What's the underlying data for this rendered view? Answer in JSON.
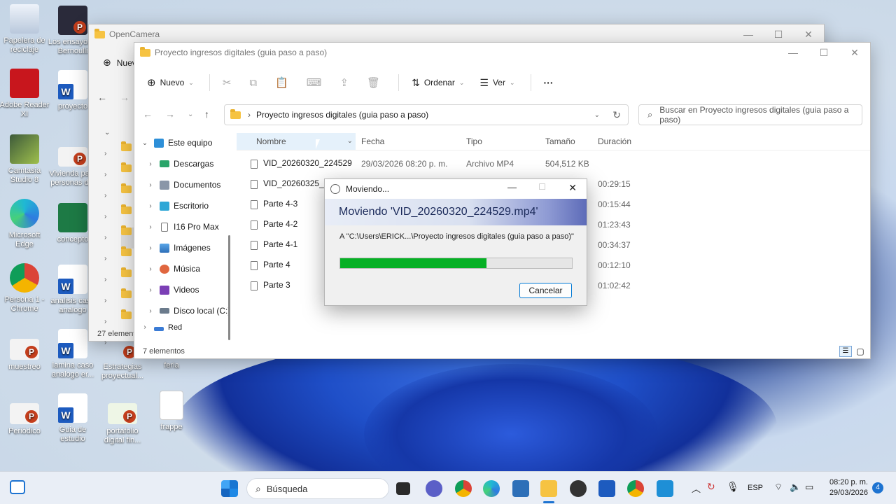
{
  "desktop": {
    "icons": [
      {
        "label": "Papelera de reciclaje"
      },
      {
        "label": "Adobe Reader XI"
      },
      {
        "label": "Camtasia Studio 8"
      },
      {
        "label": "Microsoft Edge"
      },
      {
        "label": "Persona 1 - Chrome"
      },
      {
        "label": "muestreo"
      },
      {
        "label": "Periódico"
      },
      {
        "label": "Los ensayos y Bernoulli"
      },
      {
        "label": "proyecto"
      },
      {
        "label": "Vivienda para personas d..."
      },
      {
        "label": "concepto"
      },
      {
        "label": "analisis caso analogo"
      },
      {
        "label": "lamina caso analogo er..."
      },
      {
        "label": "Guia de estudio"
      },
      {
        "label": "Estrategias proyectual..."
      },
      {
        "label": "portafolio digital fin..."
      },
      {
        "label": "feria"
      },
      {
        "label": "frappe"
      }
    ]
  },
  "back_window": {
    "title": "OpenCamera",
    "new_label": "Nuevo",
    "status": "27 elementos"
  },
  "explorer": {
    "title": "Proyecto ingresos digitales (guia paso a paso)",
    "toolbar": {
      "new_label": "Nuevo",
      "sort_label": "Ordenar",
      "view_label": "Ver",
      "more_label": "···"
    },
    "address": "Proyecto ingresos digitales (guia paso a paso)",
    "search_placeholder": "Buscar en Proyecto ingresos digitales (guia paso a paso)",
    "nav": [
      {
        "label": "Este equipo"
      },
      {
        "label": "Descargas"
      },
      {
        "label": "Documentos"
      },
      {
        "label": "Escritorio"
      },
      {
        "label": "I16 Pro Max"
      },
      {
        "label": "Imágenes"
      },
      {
        "label": "Música"
      },
      {
        "label": "Videos"
      },
      {
        "label": "Disco local (C:)"
      },
      {
        "label": "Red"
      }
    ],
    "columns": {
      "name": "Nombre",
      "date": "Fecha",
      "type": "Tipo",
      "size": "Tamaño",
      "duration": "Duración"
    },
    "files": [
      {
        "name": "VID_20260320_224529",
        "date": "29/03/2026 08:20 p. m.",
        "type": "Archivo MP4",
        "size": "504,512 KB",
        "duration": ""
      },
      {
        "name": "VID_20260325_1923",
        "date": "",
        "type": "",
        "size": "",
        "duration": "00:29:15"
      },
      {
        "name": "Parte 4-3",
        "date": "",
        "type": "",
        "size": "",
        "duration": "00:15:44"
      },
      {
        "name": "Parte 4-2",
        "date": "",
        "type": "",
        "size": "",
        "duration": "01:23:43"
      },
      {
        "name": "Parte 4-1",
        "date": "",
        "type": "",
        "size": "",
        "duration": "00:34:37"
      },
      {
        "name": "Parte 4",
        "date": "",
        "type": "",
        "size": "",
        "duration": "00:12:10"
      },
      {
        "name": "Parte 3",
        "date": "",
        "type": "",
        "size": "",
        "duration": "01:02:42"
      }
    ],
    "status": "7 elementos"
  },
  "dialog": {
    "title": "Moviendo...",
    "heading": "Moviendo 'VID_20260320_224529.mp4'",
    "destination": "A \"C:\\Users\\ERICK...\\Proyecto ingresos digitales (guia paso a paso)\"",
    "progress": 0.63,
    "cancel_label": "Cancelar"
  },
  "taskbar": {
    "search_placeholder": "Búsqueda",
    "lang": "ESP",
    "time": "08:20 p. m.",
    "date": "29/03/2026",
    "notifications": "4"
  }
}
